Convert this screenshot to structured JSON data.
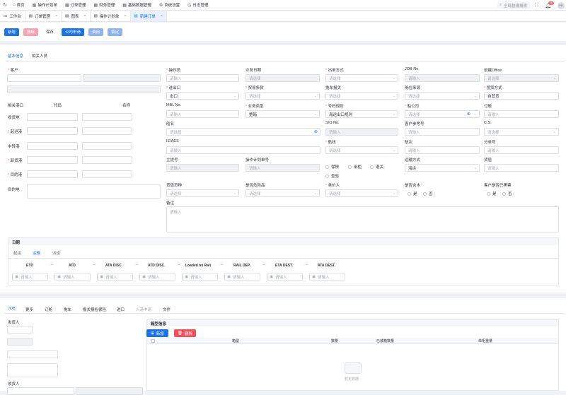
{
  "topnav": {
    "items": [
      {
        "icon": "home-icon",
        "label": "首页"
      },
      {
        "icon": "grid-icon",
        "label": "操作计划单"
      },
      {
        "icon": "grid-icon",
        "label": "订单管理"
      },
      {
        "icon": "grid-icon",
        "label": "财务管理"
      },
      {
        "icon": "grid-icon",
        "label": "基础数据管理"
      },
      {
        "icon": "gear-icon",
        "label": "系统设置"
      },
      {
        "icon": "clock-icon",
        "label": "日志管理"
      }
    ],
    "search_placeholder": "全局快捷搜索",
    "badge": "17",
    "avatar": "PU"
  },
  "tabs": [
    {
      "label": "工作台",
      "closable": false,
      "active": false
    },
    {
      "label": "订单管理",
      "closable": true,
      "active": false
    },
    {
      "label": "图表",
      "closable": true,
      "active": false
    },
    {
      "label": "操作计划单",
      "closable": true,
      "active": false
    },
    {
      "label": "新建订单",
      "closable": true,
      "active": true
    }
  ],
  "toolbar": {
    "new": "新增",
    "delete": "删除",
    "save": "保存",
    "company_apply": "公司申请",
    "fee": "费用",
    "lock": "锁定"
  },
  "subtabs": [
    "基本信息",
    "相关人员"
  ],
  "left": {
    "customer": "客户",
    "port_header": "相关港口",
    "code_header": "代码",
    "name_header": "名称",
    "ports": [
      "收货地",
      "起运港",
      "中转港",
      "卸货港",
      "目的港"
    ],
    "dest": "目的地"
  },
  "fields": {
    "operator": "操作员",
    "biz_date": "业务日期",
    "issue_mode": "出单方式",
    "job_no": "JOB No.",
    "created_office": "创建Office",
    "in_out": "进出口",
    "trade_term": "贸易条款",
    "tow_declare": "拖车报关",
    "space_source": "舱位来源",
    "pay_method": "揽货方式",
    "mbl_no": "MBL No.",
    "biz_type": "业务类型",
    "number_rule": "号码规则",
    "carrier": "船公司",
    "booking": "订舱",
    "vessel": "船名",
    "so_no": "S/O No.",
    "customer_ref": "客户参考号",
    "cs": "C.S.",
    "ie_aes": "IE/AES",
    "route": "航线",
    "voyage": "航次",
    "sub_no": "分单号",
    "main_no": "主提号",
    "plan_no": "操作计划单号",
    "transport": "运输方式",
    "goods": "货值",
    "currency": "货值币种",
    "dangerous": "是否危险品",
    "payer": "拿价人",
    "with_wood": "是否含木",
    "customer_done": "客户是否已黑票",
    "remarks": "备注"
  },
  "values": {
    "ph": "请选择",
    "ph_in": "请输入",
    "in_out": "出口",
    "trade": "自营货",
    "biz_type": "整箱",
    "number_rule": "海运出口规则",
    "transport": "海运"
  },
  "radios": {
    "insured": "保税",
    "fumigate": "用柜",
    "inspect": "退关",
    "check": "查验",
    "yes": "是",
    "no": "否"
  },
  "dates": {
    "title": "日期",
    "tabs": [
      "起运",
      "运输",
      "派送"
    ],
    "milestones": [
      "ETD",
      "ATD",
      "ATA DISC.",
      "ATD DISC.",
      "Loaded on Rail",
      "RAIL DEP.",
      "ETA DEST.",
      "ATA DEST."
    ],
    "ph": "请输入"
  },
  "bottom": {
    "tabs": [
      "JOB",
      "更多",
      "订舱",
      "拖车",
      "报关报检保险",
      "进口",
      "入港申请",
      "文件"
    ],
    "shipper": "发货人",
    "consignee": "收货人",
    "container_title": "箱型信息",
    "add": "新增",
    "del": "删除",
    "cols": [
      "箱型",
      "数量",
      "已装箱数量",
      "单柜重量"
    ],
    "empty": "暂无数据"
  },
  "colors": {
    "primary": "#1a73e8",
    "danger": "#f56c6c"
  }
}
